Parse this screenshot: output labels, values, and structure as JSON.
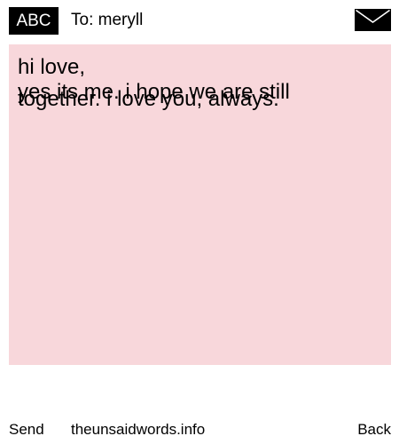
{
  "header": {
    "keyboard_mode": "ABC",
    "to_label": "To:",
    "recipient": "meryll",
    "envelope_icon": "envelope-icon"
  },
  "message": {
    "greeting": "hi love,",
    "lines": [
      "yes its me. i hope we are still",
      "together. i love you, always."
    ],
    "background_color": "#f8d7db"
  },
  "footer": {
    "send_label": "Send",
    "site": "theunsaidwords.info",
    "back_label": "Back"
  }
}
